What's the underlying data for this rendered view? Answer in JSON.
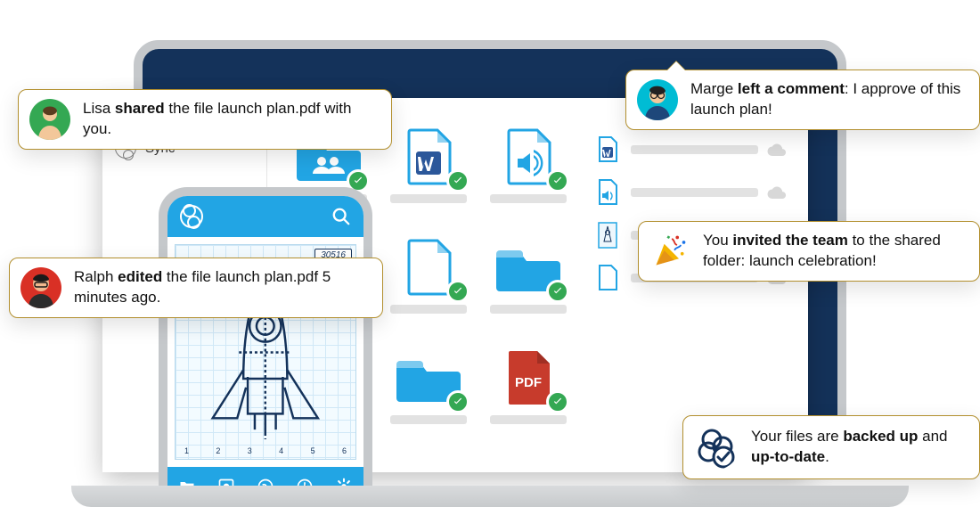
{
  "colors": {
    "accent": "#22a5e4",
    "navy": "#14325a",
    "green": "#34a853",
    "border_gold": "#b28f2e",
    "pdf_red": "#c73b2c"
  },
  "laptop": {
    "sidebar": {
      "sync_label": "Sync"
    },
    "rows_count": 4
  },
  "phone": {
    "blueprint_label": "30516",
    "axis_labels": [
      "1",
      "2",
      "3",
      "4",
      "5",
      "6"
    ]
  },
  "notifications": {
    "lisa": {
      "pre": "Lisa ",
      "bold": "shared",
      "post": " the file launch plan.pdf with you."
    },
    "ralph": {
      "pre": "Ralph ",
      "bold": "edited",
      "post": " the file launch plan.pdf 5 minutes ago."
    },
    "marge": {
      "pre": "Marge ",
      "bold": "left a comment",
      "post": ": I approve of this launch plan!"
    },
    "invite": {
      "pre": "You ",
      "bold": "invited the team",
      "post": " to the shared folder: launch celebration!"
    },
    "backup": {
      "pre": "Your files are ",
      "bold1": "backed up",
      "mid": " and ",
      "bold2": "up-to-date",
      "post": "."
    }
  }
}
